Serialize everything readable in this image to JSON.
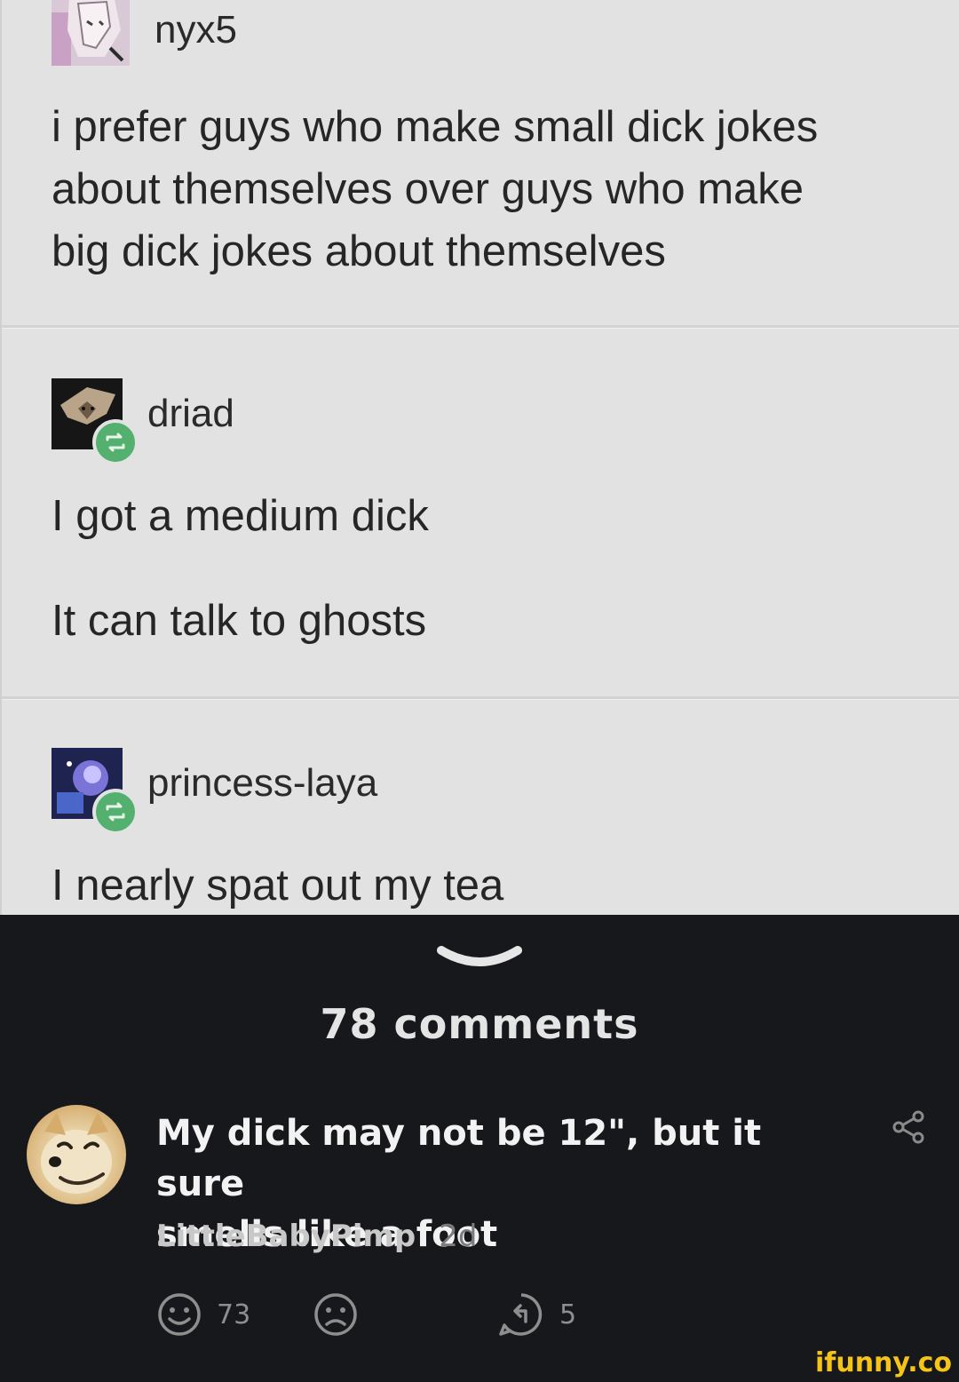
{
  "posts": [
    {
      "username": "nyx5",
      "lines": [
        "i prefer guys who make small dick jokes",
        "about themselves over guys who make",
        "big dick jokes about themselves"
      ]
    },
    {
      "username": "driad",
      "lines": [
        "I got a medium dick",
        "It can talk to ghosts"
      ]
    },
    {
      "username": "princess-laya",
      "lines": [
        "I nearly spat out my tea"
      ]
    }
  ],
  "comments_header": "78 comments",
  "comment": {
    "text_line1": "My dick may not be 12\", but it sure",
    "text_line2": "smells like a foot",
    "author": "LittleBabyPimp",
    "time": "2d",
    "smiles": "73",
    "replies": "5"
  },
  "watermark": "ifunny.co",
  "colors": {
    "screenshot_bg": "#e2e2e2",
    "dark_bg": "#17181c",
    "reblog_green": "#53b06f",
    "watermark_yellow": "#f6c416"
  }
}
